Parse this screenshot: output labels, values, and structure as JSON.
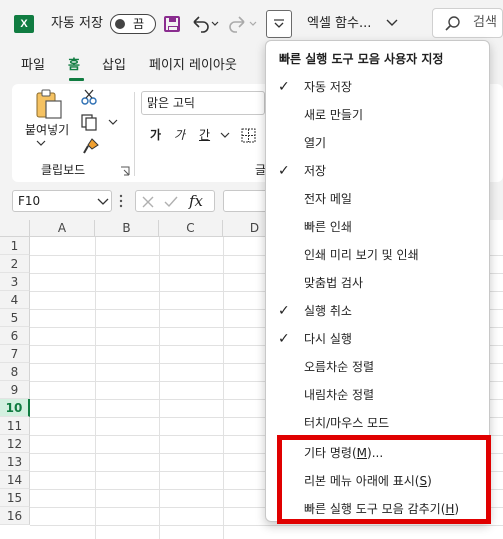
{
  "titlebar": {
    "app_icon": "excel-logo",
    "app_letter": "X",
    "autosave_label": "자동 저장",
    "toggle_state": "끔",
    "save_icon": "save-icon",
    "undo_icon": "undo-icon",
    "redo_icon": "redo-icon",
    "qat_customize_icon": "chevron-down-icon",
    "title": "엑셀 함수...",
    "title_chevron_icon": "chevron-down-icon",
    "search_icon": "search-icon",
    "search_label": "검색"
  },
  "ribbon_tabs": [
    "파일",
    "홈",
    "삽입",
    "페이지 레이아웃"
  ],
  "ribbon": {
    "paste_label": "붙여넣기",
    "clipboard_group_label": "클립보드",
    "font_name": "맑은 고딕",
    "bold": "가",
    "italic": "가",
    "underline": "간",
    "font_group_label_partial": "글",
    "cut_icon": "scissors-icon",
    "copy_icon": "copy-icon",
    "format_painter_icon": "brush-icon",
    "border_icon": "border-icon",
    "dialog_launcher_icon": "dialog-launcher-icon"
  },
  "formula_bar": {
    "name_box": "F10",
    "fx_label": "fx"
  },
  "grid": {
    "columns": [
      "A",
      "B",
      "C",
      "D"
    ],
    "rows": [
      "1",
      "2",
      "3",
      "4",
      "5",
      "6",
      "7",
      "8",
      "9",
      "10",
      "11",
      "12",
      "13",
      "14",
      "15",
      "16"
    ],
    "selected_row": "10"
  },
  "menu": {
    "title": "빠른 실행 도구 모음 사용자 지정",
    "items": [
      {
        "label": "자동 저장",
        "checked": true
      },
      {
        "label": "새로 만들기",
        "checked": false
      },
      {
        "label": "열기",
        "checked": false
      },
      {
        "label": "저장",
        "checked": true
      },
      {
        "label": "전자 메일",
        "checked": false
      },
      {
        "label": "빠른 인쇄",
        "checked": false
      },
      {
        "label": "인쇄 미리 보기 및 인쇄",
        "checked": false
      },
      {
        "label": "맞춤법 검사",
        "checked": false
      },
      {
        "label": "실행 취소",
        "checked": true
      },
      {
        "label": "다시 실행",
        "checked": true
      },
      {
        "label": "오름차순 정렬",
        "checked": false
      },
      {
        "label": "내림차순 정렬",
        "checked": false
      },
      {
        "label": "터치/마우스 모드",
        "checked": false
      }
    ],
    "more_commands": {
      "text": "기타 명령(",
      "key": "M",
      "tail": ")..."
    },
    "show_below_ribbon": {
      "text": "리본 메뉴 아래에 표시(",
      "key": "S",
      "tail": ")"
    },
    "hide_qat": {
      "text": "빠른 실행 도구 모음 감추기(",
      "key": "H",
      "tail": ")"
    },
    "check_glyph": "✓"
  },
  "colors": {
    "excel_green": "#107c41",
    "highlight_red": "#e00000",
    "save_purple": "#8a2d8f"
  }
}
